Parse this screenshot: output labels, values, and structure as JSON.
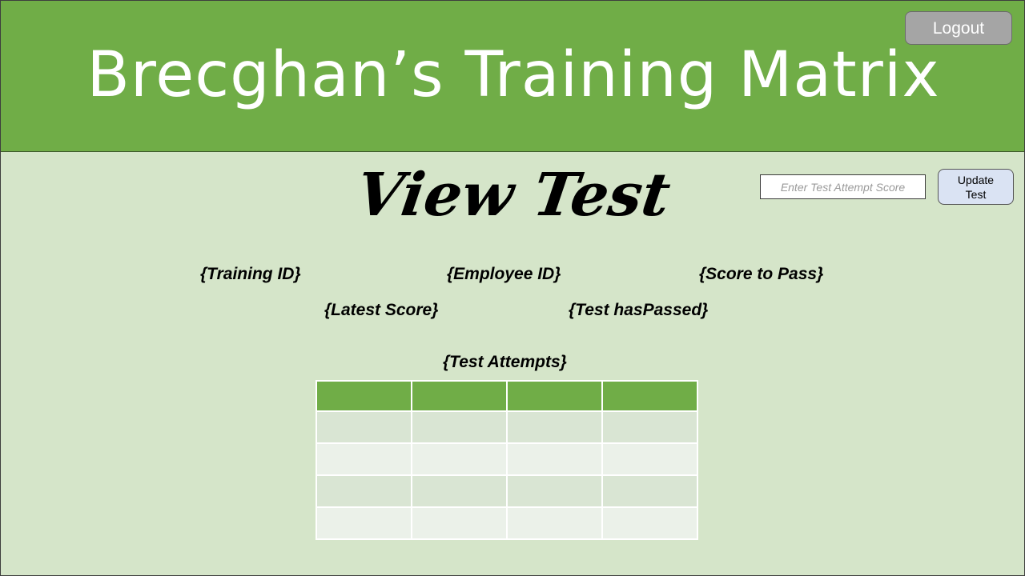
{
  "header": {
    "app_title": "Brecghan’s Training Matrix",
    "logout_label": "Logout"
  },
  "page": {
    "title": "View Test"
  },
  "update_form": {
    "score_placeholder": "Enter Test Attempt Score",
    "score_value": "",
    "update_label": "Update Test"
  },
  "fields": {
    "training_id": "{Training ID}",
    "employee_id": "{Employee ID}",
    "score_to_pass": "{Score to Pass}",
    "latest_score": "{Latest Score}",
    "test_has_passed": "{Test hasPassed}",
    "test_attempts": "{Test Attempts}"
  },
  "attempts_table": {
    "columns": [
      "",
      "",
      "",
      ""
    ],
    "rows": [
      [
        "",
        "",
        "",
        ""
      ],
      [
        "",
        "",
        "",
        ""
      ],
      [
        "",
        "",
        "",
        ""
      ],
      [
        "",
        "",
        "",
        ""
      ]
    ]
  },
  "colors": {
    "header_bg": "#70ad47",
    "body_bg": "#d5e5c9",
    "logout_bg": "#a5a5a5",
    "update_bg": "#dae3f3"
  }
}
